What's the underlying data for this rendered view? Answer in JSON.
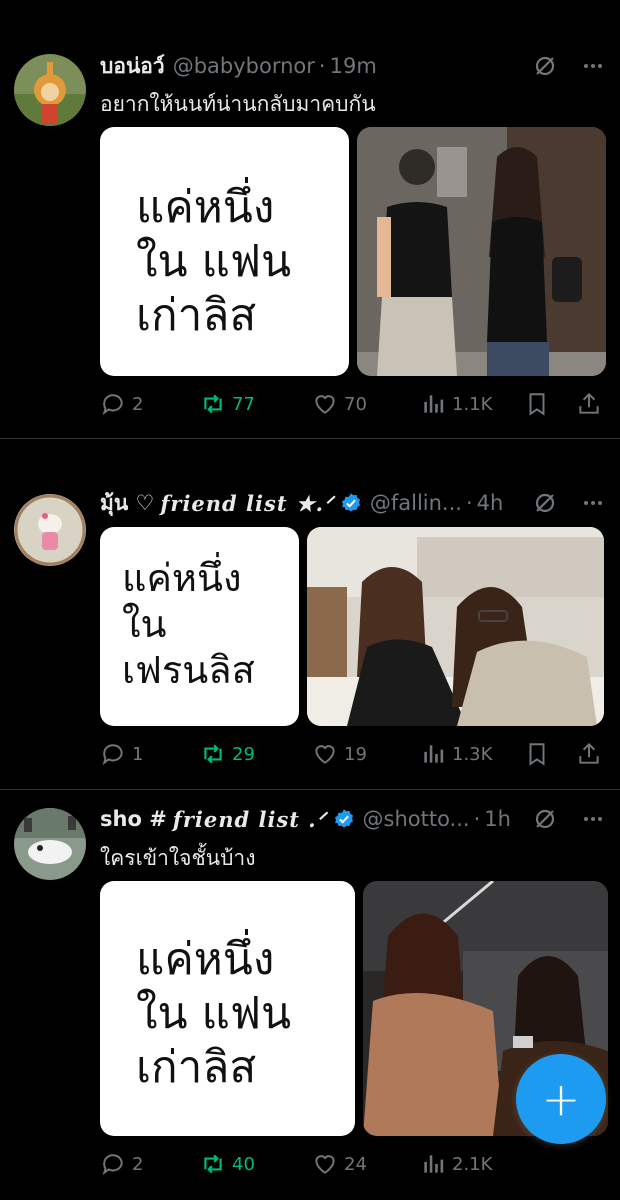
{
  "tweets": [
    {
      "name": "บอน่อว์",
      "name_fancy": "",
      "handle": "@babybornor",
      "time": "19m",
      "text": "อยากให้นนท์น่านกลับมาคบกัน",
      "card_text": "แค่หนึ่ง\nใน แฟน\nเก่าลิส",
      "stats": {
        "replies": "2",
        "reposts": "77",
        "likes": "70",
        "views": "1.1K"
      },
      "verified": false
    },
    {
      "name": "มุ้น ♡",
      "name_fancy": "friend list ★.ᐟ",
      "handle": "@fallin...",
      "time": "4h",
      "text": "",
      "card_text": "แค่หนึ่ง\nใน\nเฟรนลิส",
      "stats": {
        "replies": "1",
        "reposts": "29",
        "likes": "19",
        "views": "1.3K"
      },
      "verified": true
    },
    {
      "name": "sho #",
      "name_fancy": "friend list .ᐟ",
      "handle": "@shotto...",
      "time": "1h",
      "text": "ใครเข้าใจชั้นบ้าง",
      "card_text": "แค่หนึ่ง\nใน แฟน\nเก่าลิส",
      "stats": {
        "replies": "2",
        "reposts": "40",
        "likes": "24",
        "views": "2.1K"
      },
      "verified": true
    }
  ],
  "fab": {
    "label": "+"
  },
  "colors": {
    "accent": "#1d9bf0",
    "repost": "#00ba7c",
    "muted": "#71767b"
  }
}
